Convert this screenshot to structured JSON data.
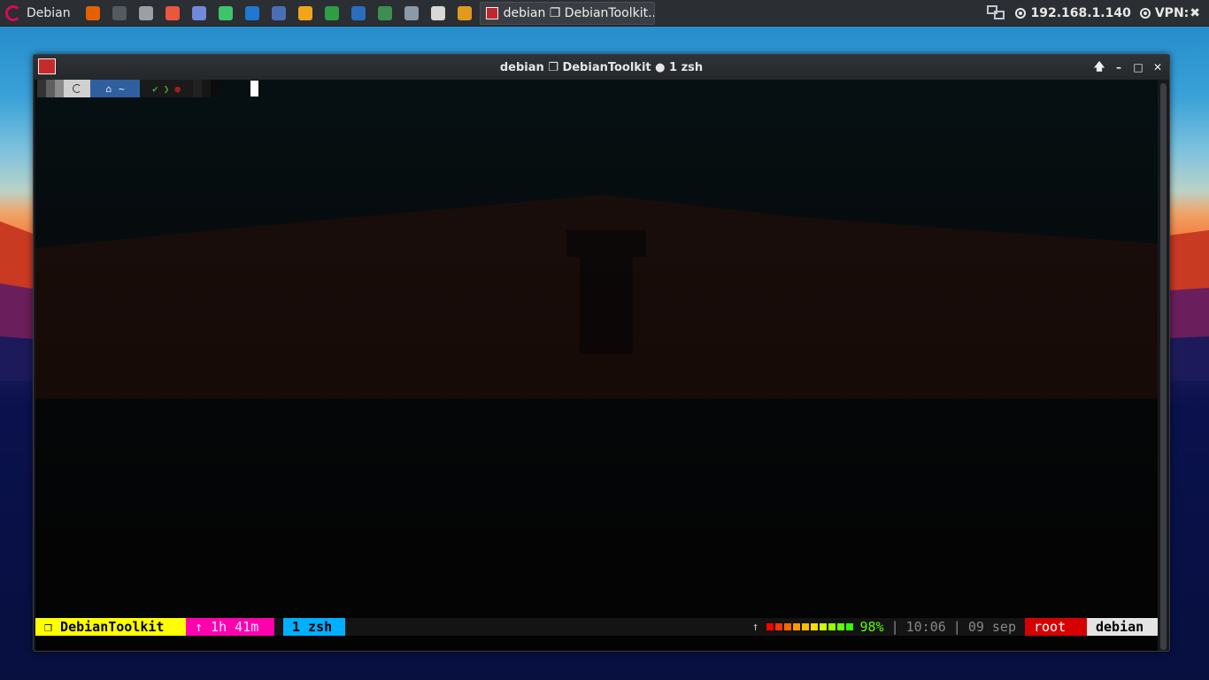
{
  "taskbar": {
    "start_label": "Debian",
    "launchers": [
      {
        "icon": "firefox-icon",
        "color": "#e66000"
      },
      {
        "icon": "terminal-icon",
        "color": "#555a60"
      },
      {
        "icon": "file-manager-icon",
        "color": "#9aa0a6"
      },
      {
        "icon": "sublime-icon",
        "color": "#e9573f"
      },
      {
        "icon": "discord-icon",
        "color": "#7289da"
      },
      {
        "icon": "lightning-icon",
        "color": "#3ec46d"
      },
      {
        "icon": "shark-icon",
        "color": "#1f78d1"
      },
      {
        "icon": "network-tool-icon",
        "color": "#4a6fb5"
      },
      {
        "icon": "editor-icon",
        "color": "#f2a51a"
      },
      {
        "icon": "spreadsheet-icon",
        "color": "#2e9e44"
      },
      {
        "icon": "document-icon",
        "color": "#2a6ebd"
      },
      {
        "icon": "globe-icon",
        "color": "#3d8f4f"
      },
      {
        "icon": "monitor-icon",
        "color": "#8a9aa6"
      },
      {
        "icon": "cheese-icon",
        "color": "#d8d8d8"
      },
      {
        "icon": "magnifier-icon",
        "color": "#e09b1f"
      }
    ],
    "active_task_label": "debian ❐ DebianToolkit...",
    "ip_address": "192.168.1.140",
    "vpn_label": "VPN:",
    "vpn_status": "✖"
  },
  "window": {
    "title": "debian ❐ DebianToolkit ● 1 zsh",
    "buttons": {
      "up": "🡅",
      "minimize": "–",
      "maximize": "□",
      "close": "✕"
    }
  },
  "prompt": {
    "home_symbol": "⌂",
    "dir": "~",
    "ok_symbol": "✔",
    "arrow_symbol": "❯",
    "dot_symbol": "●"
  },
  "status": {
    "session": "❐ DebianToolkit",
    "uptime": "↑ 1h 41m",
    "window": "1 zsh",
    "up_arrow": "↑",
    "battery_percent": "98%",
    "sep1": "|",
    "time": "10:06",
    "sep2": "|",
    "date": "09 sep",
    "user": "root",
    "host": "debian",
    "colors": {
      "session_bg": "#ffff00",
      "uptime_bg": "#ff00af",
      "window_bg": "#00afff",
      "battery_text": "#5fff00",
      "user_bg": "#d70000",
      "host_bg": "#e4e4e4"
    }
  }
}
